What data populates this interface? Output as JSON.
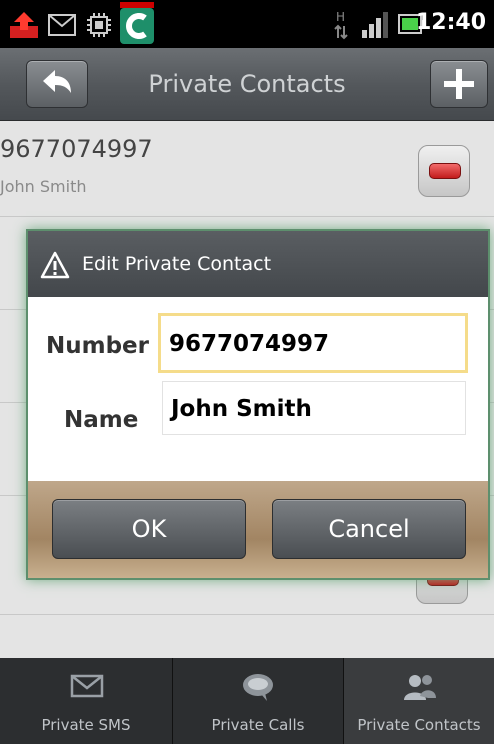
{
  "status_bar": {
    "time": "12:40"
  },
  "title_bar": {
    "title": "Private Contacts"
  },
  "contacts": [
    {
      "number": "9677074997",
      "name": "John Smith"
    }
  ],
  "dialog": {
    "title": "Edit Private Contact",
    "number_label": "Number",
    "number_value": "9677074997",
    "name_label": "Name",
    "name_value": "John Smith",
    "ok_label": "OK",
    "cancel_label": "Cancel"
  },
  "tabs": [
    {
      "label": "Private SMS",
      "icon": "envelope-icon"
    },
    {
      "label": "Private Calls",
      "icon": "speech-bubble-icon"
    },
    {
      "label": "Private Contacts",
      "icon": "contacts-icon",
      "active": true
    }
  ]
}
